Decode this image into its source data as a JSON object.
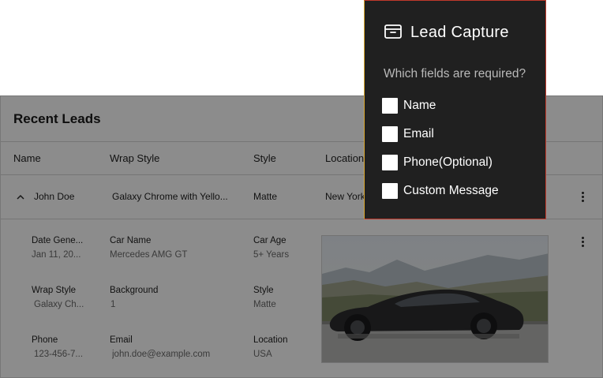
{
  "leads_card": {
    "title": "Recent Leads",
    "columns": [
      "Name",
      "Wrap Style",
      "Style",
      "Location"
    ],
    "row": {
      "name": "John Doe",
      "wrap_style": "Galaxy Chrome with Yello...",
      "style": "Matte",
      "location": "New York"
    },
    "details": {
      "date_label": "Date Gene...",
      "date_value": "Jan 11, 20...",
      "car_name_label": "Car Name",
      "car_name_value": "Mercedes AMG GT",
      "car_age_label": "Car Age",
      "car_age_value": "5+ Years",
      "wrap_style_label": "Wrap Style",
      "wrap_style_value": "Galaxy Ch...",
      "background_label": "Background",
      "background_value": "1",
      "style_label": "Style",
      "style_value": "Matte",
      "phone_label": "Phone",
      "phone_value": "123-456-7...",
      "email_label": "Email",
      "email_value": "john.doe@example.com",
      "location_label": "Location",
      "location_value": "USA"
    }
  },
  "lead_capture": {
    "icon": "archive-box-icon",
    "title": "Lead Capture",
    "question": "Which fields are required?",
    "options": [
      {
        "label": "Name",
        "checked": false
      },
      {
        "label": "Email",
        "checked": false
      },
      {
        "label": "Phone(Optional)",
        "checked": false
      },
      {
        "label": "Custom Message",
        "checked": false
      }
    ]
  },
  "colors": {
    "popover_bg": "#202020",
    "overlay": "rgba(0,0,0,0.45)",
    "border_accent_red": "#c0392b",
    "border_accent_gold": "#d9a52b"
  }
}
